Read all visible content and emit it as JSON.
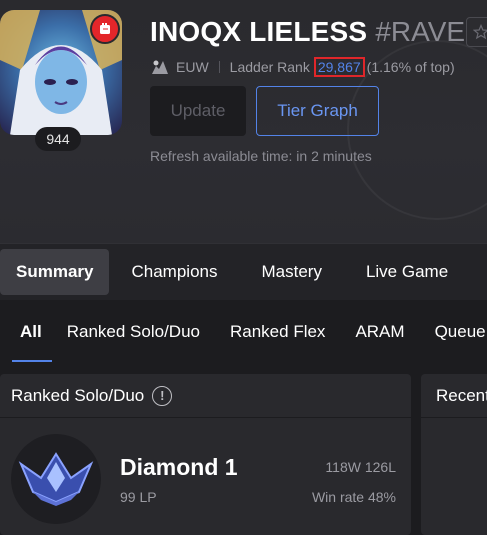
{
  "profile": {
    "name": "INOQX LIELESS",
    "tagline": "#RAVE",
    "level": "944",
    "region": "EUW",
    "ladder_label": "Ladder Rank",
    "ladder_rank": "29,867",
    "ladder_percent": "(1.16% of top)",
    "update_label": "Update",
    "tier_graph_label": "Tier Graph",
    "refresh_text": "Refresh available time: in 2 minutes"
  },
  "nav_tabs": [
    {
      "label": "Summary"
    },
    {
      "label": "Champions"
    },
    {
      "label": "Mastery"
    },
    {
      "label": "Live Game"
    }
  ],
  "queue_tabs": [
    {
      "label": "All"
    },
    {
      "label": "Ranked Solo/Duo"
    },
    {
      "label": "Ranked Flex"
    },
    {
      "label": "ARAM"
    },
    {
      "label": "Queue"
    }
  ],
  "ranked_card": {
    "title": "Ranked Solo/Duo",
    "info_glyph": "!",
    "tier": "Diamond 1",
    "lp": "99 LP",
    "record": "118W 126L",
    "win_rate": "Win rate 48%"
  },
  "recent_card": {
    "title": "Recent"
  },
  "colors": {
    "accent": "#5383e8",
    "highlight_box": "#e0262a",
    "riot_badge": "#e3262a",
    "background": "#1c1c1f",
    "card": "#29292d"
  },
  "icons": {
    "riot": "riot-fist-icon",
    "region": "region-minion-icon",
    "favorite": "star-icon",
    "info": "info-icon",
    "emblem": "diamond-emblem-icon"
  }
}
